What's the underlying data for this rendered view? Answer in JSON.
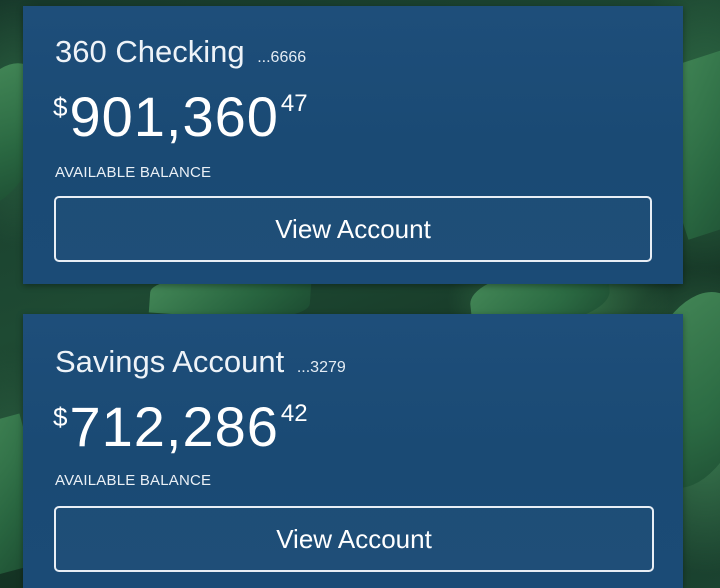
{
  "accounts": [
    {
      "name": "360 Checking",
      "mask": "...6666",
      "currency": "$",
      "balance_main": "901,360",
      "balance_cents": "47",
      "balance_label": "AVAILABLE BALANCE",
      "button_label": "View Account"
    },
    {
      "name": "Savings Account",
      "mask": "...3279",
      "currency": "$",
      "balance_main": "712,286",
      "balance_cents": "42",
      "balance_label": "AVAILABLE BALANCE",
      "button_label": "View Account"
    }
  ],
  "colors": {
    "card_background": "#1b4b76",
    "text": "#ffffff",
    "background_foliage": "#1e4a33"
  }
}
